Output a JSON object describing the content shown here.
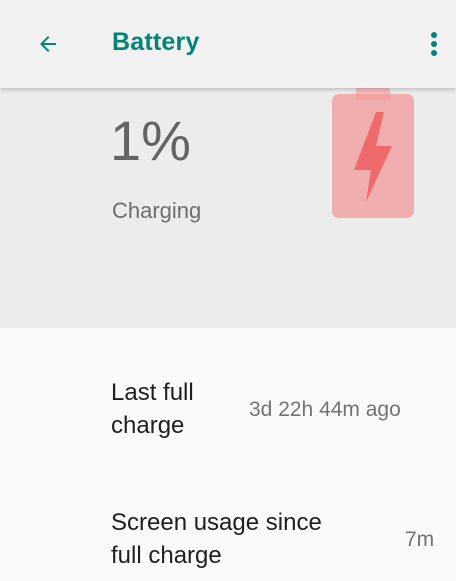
{
  "app_bar": {
    "title": "Battery",
    "back_icon": "arrow-back-icon",
    "menu_icon": "more-vert-icon",
    "accent_color": "#008577"
  },
  "battery": {
    "level_text": "1%",
    "level": 1,
    "status": "Charging",
    "icon": "battery-charging-icon",
    "icon_color": "#f28b8b"
  },
  "stats": [
    {
      "label_line1": "Last full",
      "label_line2": "charge",
      "value": "3d 22h 44m ago"
    },
    {
      "label_line1": "Screen usage since",
      "label_line2": "full charge",
      "value": "7m"
    }
  ]
}
